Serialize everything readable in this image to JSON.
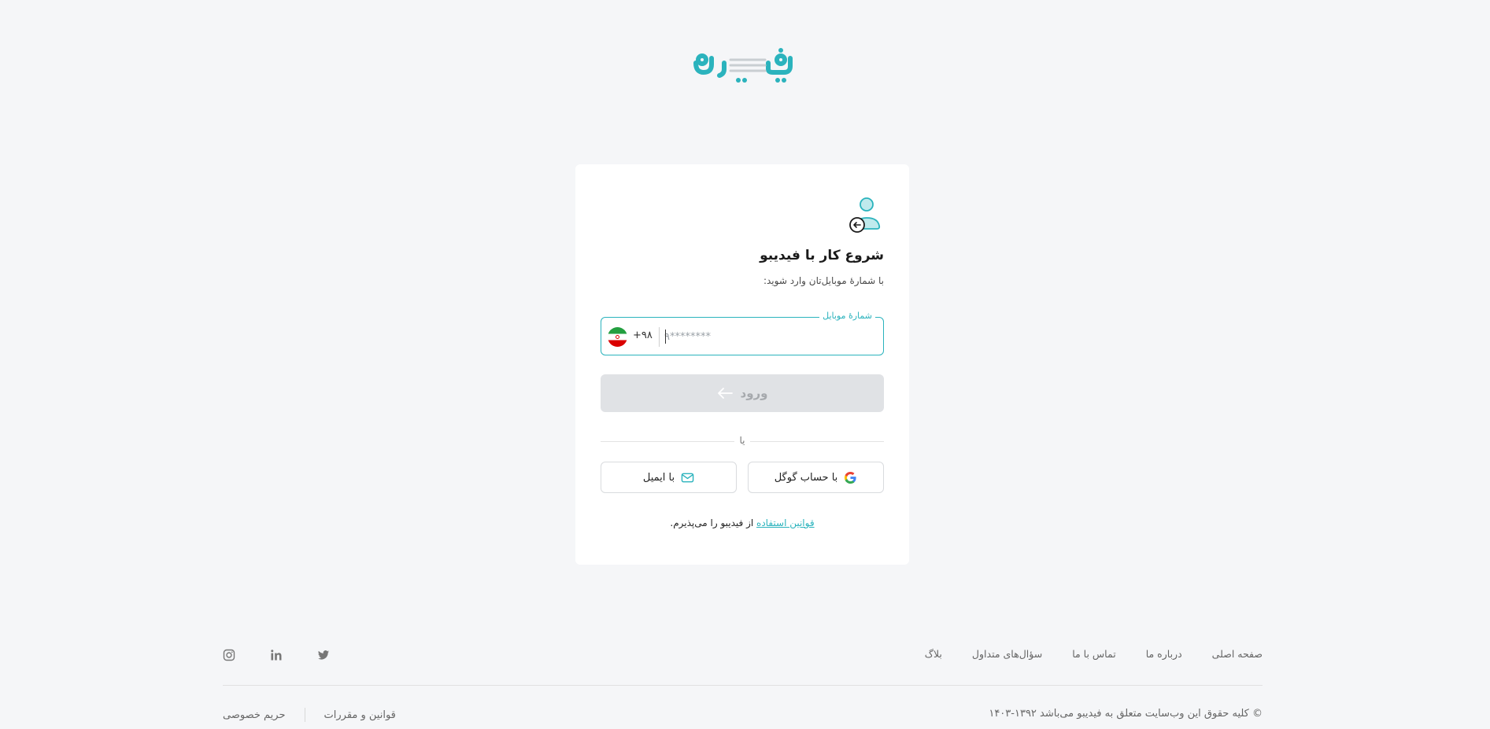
{
  "brand": {
    "logo_text": "فیدیبو",
    "accent": "#2bb3bd"
  },
  "login": {
    "title": "شروع کار با فیدیبو",
    "subtitle": "با شمارهٔ موبایل‌تان وارد شوید:",
    "phone_label": "شمارهٔ موبایل",
    "country_code": "+۹۸",
    "phone_placeholder": "۹********",
    "phone_value": "",
    "submit_label": "ورود",
    "or_label": "یا",
    "google_label": "با حساب گوگل",
    "email_label": "با ایمیل",
    "terms_link": "قوانین استفاده",
    "terms_text": "از فیدیبو را می‌پذیرم."
  },
  "footer": {
    "links": [
      "صفحه اصلی",
      "درباره ما",
      "تماس با ما",
      "سؤال‌های متداول",
      "بلاگ"
    ],
    "social_icons": [
      "twitter-icon",
      "linkedin-icon",
      "instagram-icon"
    ],
    "copyright": "© کلیه حقوق این وب‌سایت متعلق به فیدیبو می‌باشد ۱۳۹۲-۱۴۰۳",
    "legal_links": [
      "قوانین و مقررات",
      "حریم خصوصی"
    ]
  }
}
